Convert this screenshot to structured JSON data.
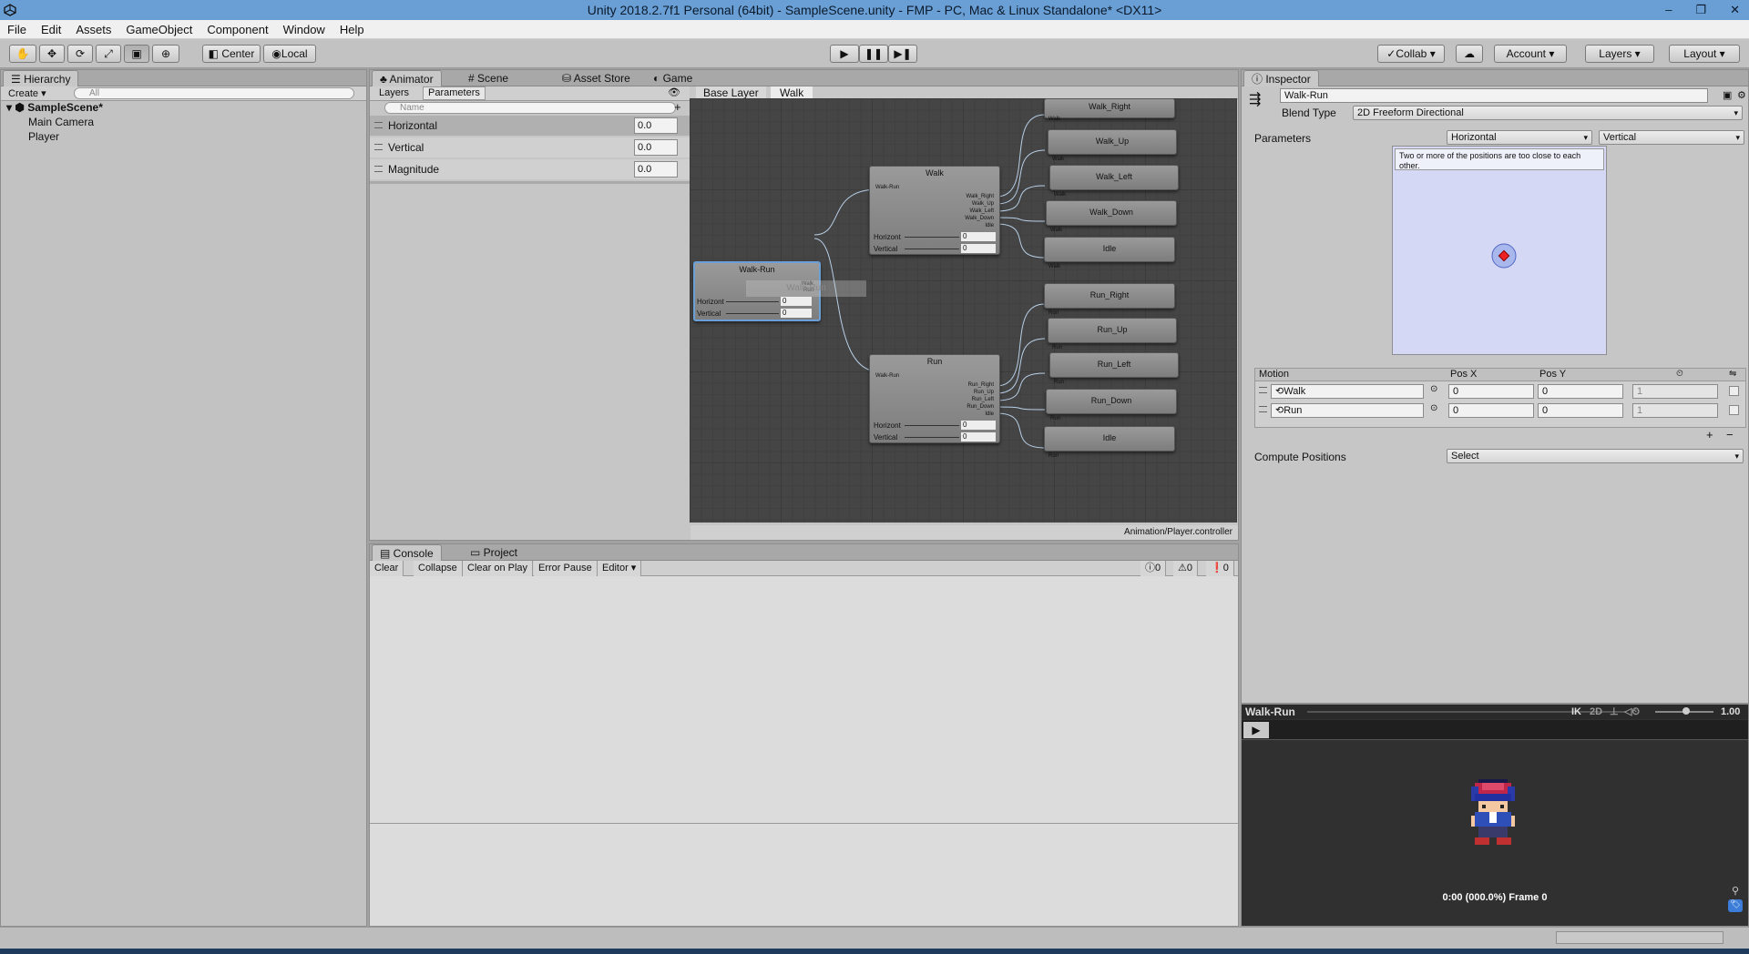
{
  "window": {
    "title": "Unity 2018.2.7f1 Personal (64bit) - SampleScene.unity - FMP - PC, Mac & Linux Standalone* <DX11>"
  },
  "menu": [
    "File",
    "Edit",
    "Assets",
    "GameObject",
    "Component",
    "Window",
    "Help"
  ],
  "toolbar": {
    "center_label": "Center",
    "local_label": "Local",
    "collab_label": "Collab",
    "account_label": "Account",
    "layers_label": "Layers",
    "layout_label": "Layout"
  },
  "hierarchy": {
    "tab": "Hierarchy",
    "create_label": "Create",
    "search_placeholder": "All",
    "scene": "SampleScene*",
    "items": [
      "Main Camera",
      "Player"
    ]
  },
  "animator": {
    "tabs": [
      "Animator",
      "Scene",
      "Asset Store",
      "Game"
    ],
    "subtabs": [
      "Layers",
      "Parameters"
    ],
    "name_placeholder": "Name",
    "parameters": [
      {
        "name": "Horizontal",
        "value": "0.0"
      },
      {
        "name": "Vertical",
        "value": "0.0"
      },
      {
        "name": "Magnitude",
        "value": "0.0"
      }
    ],
    "breadcrumb": [
      "Base Layer",
      "Walk"
    ],
    "footer_path": "Animation/Player.controller",
    "nodes": {
      "walk_run": {
        "title": "Walk-Run",
        "out1": "Walk",
        "out2": "Run",
        "p1": "Horizont",
        "p2": "Vertical",
        "v1": "0",
        "v2": "0",
        "ghost": "Walk-Run"
      },
      "walk": {
        "title": "Walk",
        "in": "Walk-Run",
        "outs": [
          "Walk_Right",
          "Walk_Up",
          "Walk_Left",
          "Walk_Down",
          "Idle"
        ],
        "p1": "Horizont",
        "p2": "Vertical",
        "v1": "0",
        "v2": "0"
      },
      "run": {
        "title": "Run",
        "in": "Walk-Run",
        "outs": [
          "Run_Right",
          "Run_Up",
          "Run_Left",
          "Run_Down",
          "Idle"
        ],
        "p1": "Horizont",
        "p2": "Vertical",
        "v1": "0",
        "v2": "0"
      },
      "walk_leaves": [
        "Walk_Right",
        "Walk_Up",
        "Walk_Left",
        "Walk_Down",
        "Idle"
      ],
      "run_leaves": [
        "Run_Right",
        "Run_Up",
        "Run_Left",
        "Run_Down",
        "Idle"
      ],
      "walk_in_label": "Walk",
      "run_in_label": "Run"
    }
  },
  "console": {
    "tabs": [
      "Console",
      "Project"
    ],
    "buttons": [
      "Clear",
      "Collapse",
      "Clear on Play",
      "Error Pause",
      "Editor"
    ],
    "counts": {
      "info": "0",
      "warn": "0",
      "error": "0"
    }
  },
  "inspector": {
    "tab": "Inspector",
    "name_value": "Walk-Run",
    "blend_type_label": "Blend Type",
    "blend_type_value": "2D Freeform Directional",
    "parameters_label": "Parameters",
    "param_x": "Horizontal",
    "param_y": "Vertical",
    "warning": "Two or more of the positions are too close to each other.",
    "motion_header": {
      "motion": "Motion",
      "posx": "Pos X",
      "posy": "Pos Y"
    },
    "motions": [
      {
        "name": "Walk",
        "posx": "0",
        "posy": "0",
        "speed": "1"
      },
      {
        "name": "Run",
        "posx": "0",
        "posy": "0",
        "speed": "1"
      }
    ],
    "compute_label": "Compute Positions",
    "compute_value": "Select"
  },
  "preview": {
    "title": "Walk-Run",
    "ik": "IK",
    "mode": "2D",
    "speed": "1.00",
    "status": "0:00 (000.0%) Frame 0"
  },
  "colors": {
    "accent": "#6a9fd6",
    "graph_bg": "#454545",
    "blend_bg": "#d4d8f4"
  }
}
